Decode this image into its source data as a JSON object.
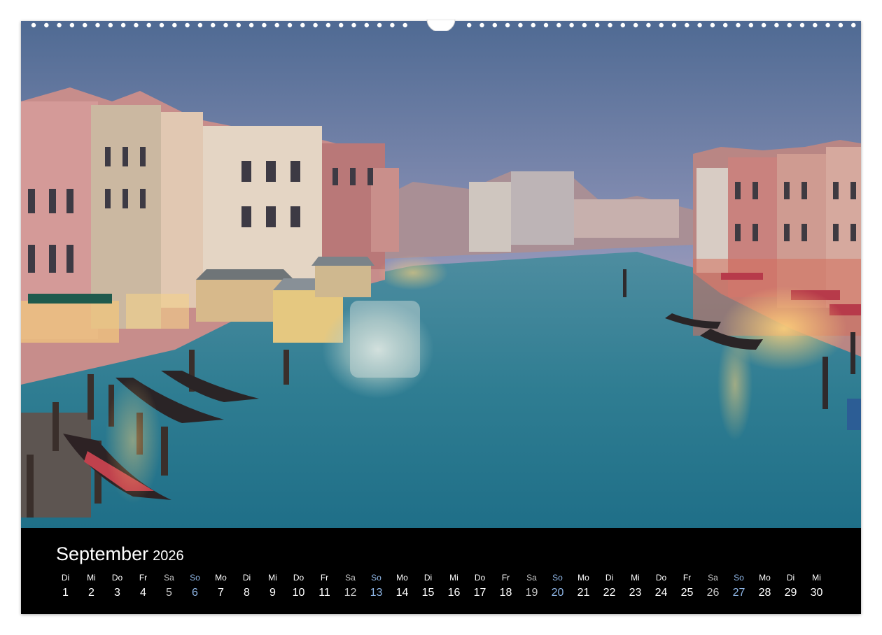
{
  "calendar": {
    "month": "September",
    "year": "2026",
    "colors": {
      "sunday": "#8fb6e6",
      "saturday": "#c9c9c9",
      "weekday": "#ffffff",
      "background": "#000000"
    },
    "weekdays": [
      "Di",
      "Mi",
      "Do",
      "Fr",
      "Sa",
      "So",
      "Mo",
      "Di",
      "Mi",
      "Do",
      "Fr",
      "Sa",
      "So",
      "Mo",
      "Di",
      "Mi",
      "Do",
      "Fr",
      "Sa",
      "So",
      "Mo",
      "Di",
      "Mi",
      "Do",
      "Fr",
      "Sa",
      "So",
      "Mo",
      "Di",
      "Mi"
    ],
    "days": [
      "1",
      "2",
      "3",
      "4",
      "5",
      "6",
      "7",
      "8",
      "9",
      "10",
      "11",
      "12",
      "13",
      "14",
      "15",
      "16",
      "17",
      "18",
      "19",
      "20",
      "21",
      "22",
      "23",
      "24",
      "25",
      "26",
      "27",
      "28",
      "29",
      "30"
    ]
  },
  "photo": {
    "subject": "venice-grand-canal-dusk-icon"
  }
}
